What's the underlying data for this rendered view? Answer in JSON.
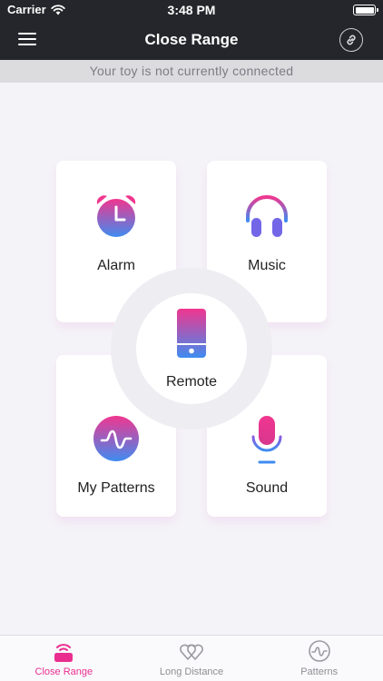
{
  "status_bar": {
    "carrier": "Carrier",
    "time": "3:48 PM",
    "battery_level": 1.0
  },
  "nav": {
    "title": "Close Range",
    "menu_icon": "hamburger-menu-icon",
    "link_icon": "link-icon"
  },
  "banner": {
    "text": "Your toy is not currently connected"
  },
  "features": {
    "alarm": {
      "label": "Alarm",
      "icon": "alarm-clock-icon"
    },
    "music": {
      "label": "Music",
      "icon": "headphones-icon"
    },
    "remote": {
      "label": "Remote",
      "icon": "phone-remote-icon"
    },
    "my_patterns": {
      "label": "My Patterns",
      "icon": "wave-pattern-icon"
    },
    "sound": {
      "label": "Sound",
      "icon": "microphone-icon"
    }
  },
  "tabs": [
    {
      "label": "Close Range",
      "icon": "close-range-icon",
      "active": true
    },
    {
      "label": "Long Distance",
      "icon": "hearts-icon",
      "active": false
    },
    {
      "label": "Patterns",
      "icon": "pattern-icon",
      "active": false
    }
  ],
  "colors": {
    "header_bg": "#25262b",
    "accent_pink": "#ea2e8f",
    "gradient_top": "#f0368f",
    "gradient_bottom": "#3f8cf0",
    "banner_bg": "#dcdcdf",
    "inactive_tab": "#8e8e93"
  }
}
